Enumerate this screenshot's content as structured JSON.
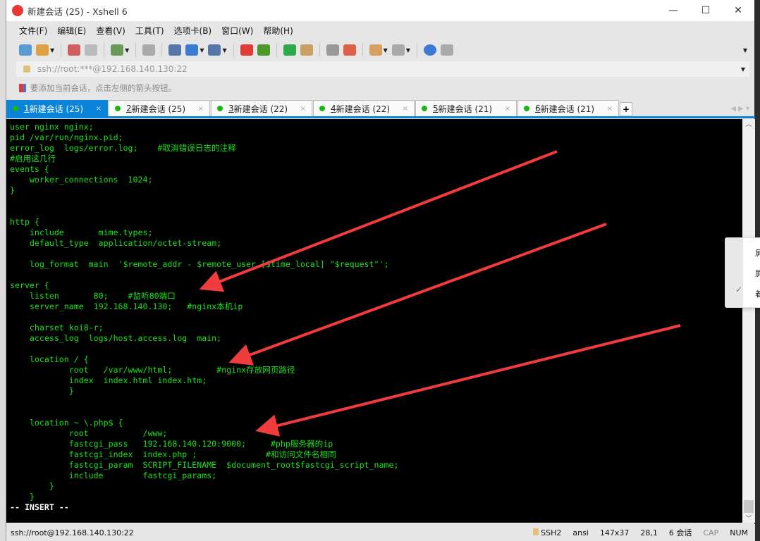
{
  "window": {
    "title": "新建会话 (25) - Xshell 6",
    "minimize": "—",
    "maximize": "☐",
    "close": "✕"
  },
  "menu": [
    "文件(F)",
    "编辑(E)",
    "查看(V)",
    "工具(T)",
    "选项卡(B)",
    "窗口(W)",
    "帮助(H)"
  ],
  "toolbar_icons": [
    {
      "name": "new-session-icon",
      "color": "#5b9bd5"
    },
    {
      "name": "open-folder-icon",
      "color": "#e0a040"
    },
    {
      "name": "disconnect-icon",
      "color": "#d06060"
    },
    {
      "name": "reconnect-icon",
      "color": "#bbbbbb"
    },
    {
      "name": "properties-icon",
      "color": "#6a9a5a"
    },
    {
      "name": "find-icon",
      "color": "#aaaaaa"
    },
    {
      "name": "transfer-icon",
      "color": "#5577aa"
    },
    {
      "name": "globe-icon",
      "color": "#3a7bd5"
    },
    {
      "name": "font-icon",
      "color": "#5577aa"
    },
    {
      "name": "xshell-logo-icon",
      "color": "#e53935"
    },
    {
      "name": "xftp-icon",
      "color": "#4a9a2a"
    },
    {
      "name": "fullscreen-icon",
      "color": "#2aaa4a"
    },
    {
      "name": "lock-icon",
      "color": "#c8a060"
    },
    {
      "name": "keyboard-icon",
      "color": "#999999"
    },
    {
      "name": "highlight-icon",
      "color": "#e0604a"
    },
    {
      "name": "add-folder-icon",
      "color": "#d8a060"
    },
    {
      "name": "layout-icon",
      "color": "#aaaaaa"
    },
    {
      "name": "help-icon",
      "color": "#3a7bd5"
    },
    {
      "name": "chat-icon",
      "color": "#aaaaaa"
    }
  ],
  "address": "ssh://root:***@192.168.140.130:22",
  "hint": "要添加当前会话，点击左侧的箭头按钮。",
  "tabs": [
    {
      "num": "1",
      "label": " 新建会话 (25)",
      "active": true
    },
    {
      "num": "2",
      "label": " 新建会话 (25)"
    },
    {
      "num": "3",
      "label": " 新建会话 (22)"
    },
    {
      "num": "4",
      "label": " 新建会话 (22)"
    },
    {
      "num": "5",
      "label": " 新建会话 (21)"
    },
    {
      "num": "6",
      "label": " 新建会话 (21)"
    }
  ],
  "tab_close": "×",
  "tab_add": "+",
  "tab_nav": "◀ ▶   ▾",
  "terminal_lines": [
    "user nginx nginx;",
    "pid /var/run/nginx.pid;",
    "error_log  logs/error.log;    #取消错误日志的注释",
    "#启用这几行",
    "events {",
    "    worker_connections  1024;",
    "}",
    "",
    "",
    "http {",
    "    include       mime.types;",
    "    default_type  application/octet-stream;",
    "",
    "    log_format  main  '$remote_addr - $remote_user [$time_local] \"$request\"';",
    "",
    "server {",
    "    listen       80;    #监听80端口",
    "    server_name  192.168.140.130;   #nginx本机ip",
    "",
    "    charset koi8-r;",
    "    access_log  logs/host.access.log  main;",
    "",
    "    location / {",
    "            root   /var/www/html;         #nginx存放网页路径",
    "            index  index.html index.htm;",
    "            }",
    "",
    "",
    "    location ~ \\.php$ {",
    "            root           /www;",
    "            fastcgi_pass   192.168.140.120:9000;     #php服务器的ip",
    "            fastcgi_index  index.php ;              #和访问文件名相同",
    "            fastcgi_param  SCRIPT_FILENAME  $document_root$fastcgi_script_name;",
    "            include        fastcgi_params;",
    "        }",
    "    }"
  ],
  "mode": "-- INSERT --",
  "status": {
    "connection": "ssh://root@192.168.140.130:22",
    "protocol": "SSH2",
    "encoding": "ansi",
    "size": "147x37",
    "cursor": "28,1",
    "sessions": "6 会话",
    "cap": "CAP",
    "num": "NUM"
  },
  "popup_items": [
    "屏",
    "屏",
    "着"
  ],
  "colors": {
    "terminal_text": "#19e119",
    "accent": "#0a84d8",
    "arrow": "#f03c3c"
  }
}
